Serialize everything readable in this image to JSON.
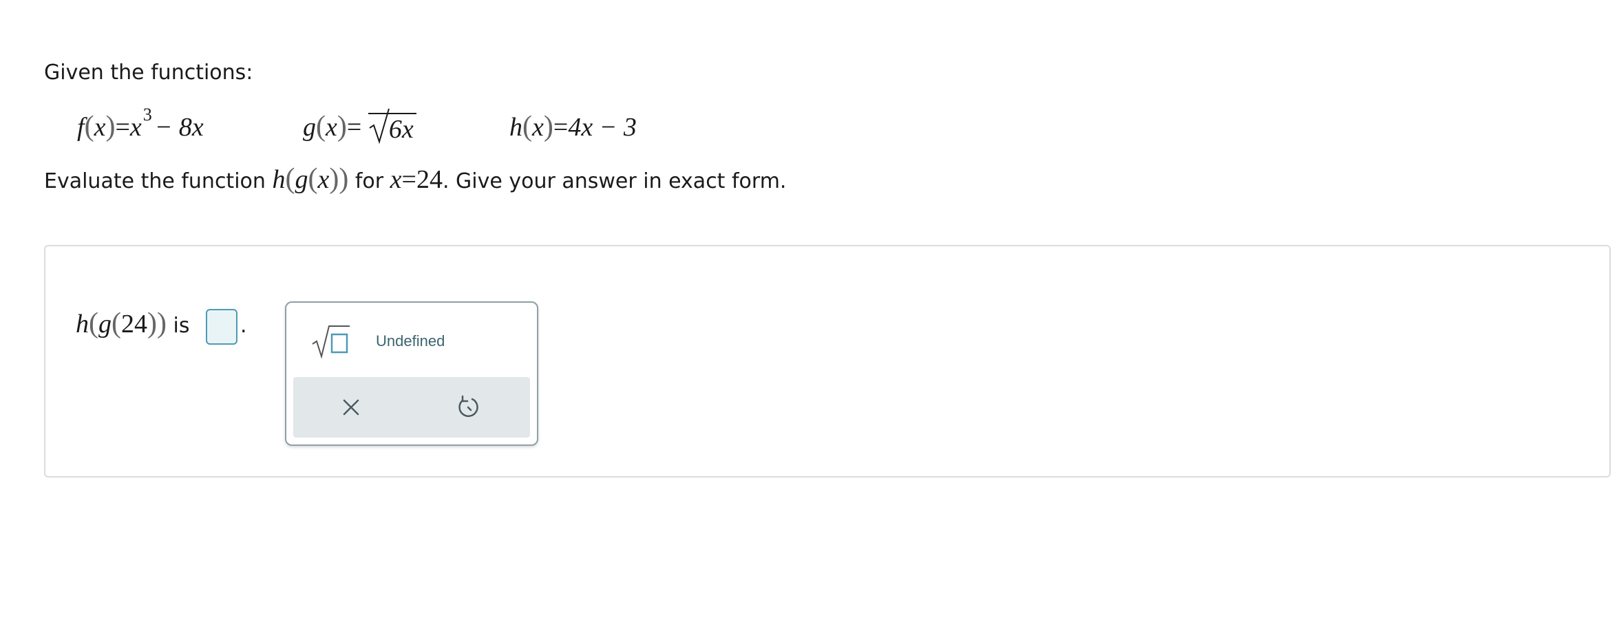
{
  "problem": {
    "intro": "Given the functions:",
    "functions": {
      "f": {
        "name": "f",
        "var": "x",
        "lhs_eq": "=",
        "base": "x",
        "exponent": "3",
        "rest": "− 8x"
      },
      "g": {
        "name": "g",
        "var": "x",
        "lhs_eq": "=",
        "radicand": "6x"
      },
      "h": {
        "name": "h",
        "var": "x",
        "lhs_eq": "=",
        "rhs": "4x − 3"
      }
    },
    "question": {
      "prefix": "Evaluate the function ",
      "outer": "h",
      "inner": "g",
      "var": "x",
      "middle": " for ",
      "eq_var": "x",
      "eq_sign": "=",
      "eq_value": "24",
      "suffix": ". Give your answer in exact form."
    }
  },
  "answer": {
    "outer": "h",
    "inner": "g",
    "arg": "24",
    "is_text": " is ",
    "input_value": "",
    "period": "."
  },
  "palette": {
    "sqrt_icon": "square-root-template-icon",
    "undefined_label": "Undefined",
    "clear_icon": "x-icon",
    "reset_icon": "undo-icon",
    "accent_color": "#4d9ab5"
  }
}
